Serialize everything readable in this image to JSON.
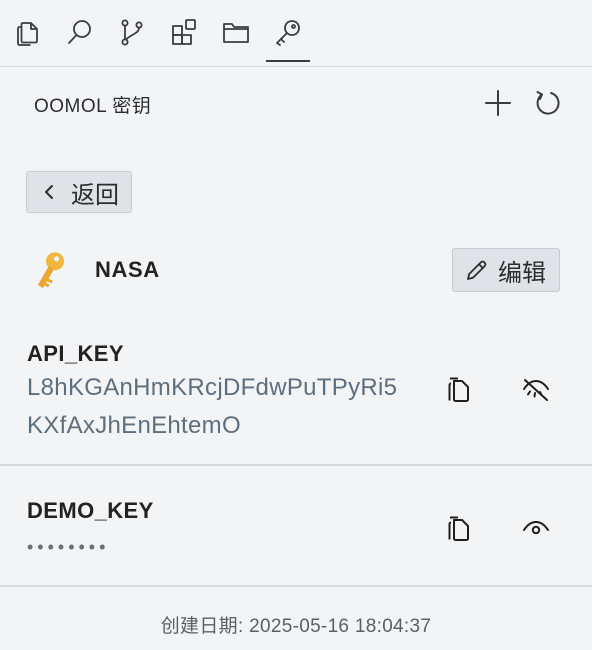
{
  "tabs": [
    {
      "icon": "copy-icon",
      "active": false
    },
    {
      "icon": "search-icon",
      "active": false
    },
    {
      "icon": "branch-icon",
      "active": false
    },
    {
      "icon": "blocks-icon",
      "active": false
    },
    {
      "icon": "folder-icon",
      "active": false
    },
    {
      "icon": "key-icon",
      "active": true
    }
  ],
  "header": {
    "title": "OOMOL 密钥",
    "add_icon": "plus-icon",
    "refresh_icon": "refresh-icon"
  },
  "back": {
    "label": "返回"
  },
  "key": {
    "name": "NASA",
    "icon": "key-emoji-icon",
    "edit_label": "编辑"
  },
  "secrets": [
    {
      "name": "API_KEY",
      "value": "L8hKGAnHmKRcjDFdwPuTPyRi5KXfAxJhEnEhtemO",
      "visible": true
    },
    {
      "name": "DEMO_KEY",
      "value": "••••••••",
      "visible": false
    }
  ],
  "footer": {
    "created": "创建日期: 2025-05-16 18:04:37"
  },
  "colors": {
    "accent": "#3b3d41",
    "value_text": "#5d6f7f",
    "key_gold": "#f2b73f"
  }
}
